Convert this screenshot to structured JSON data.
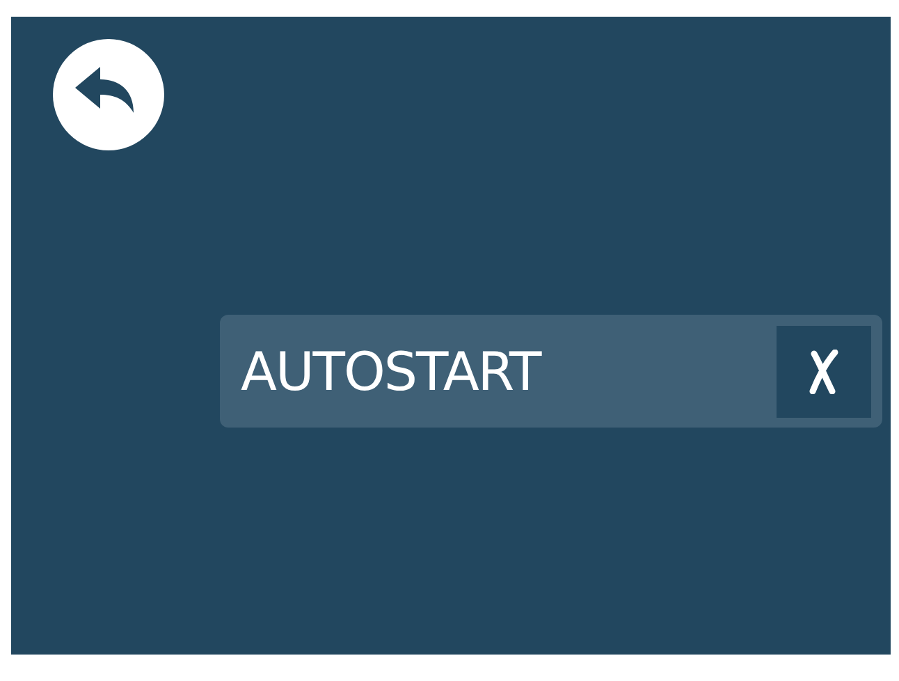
{
  "settings": [
    {
      "label": "AUTOSTART",
      "checked": false
    }
  ]
}
